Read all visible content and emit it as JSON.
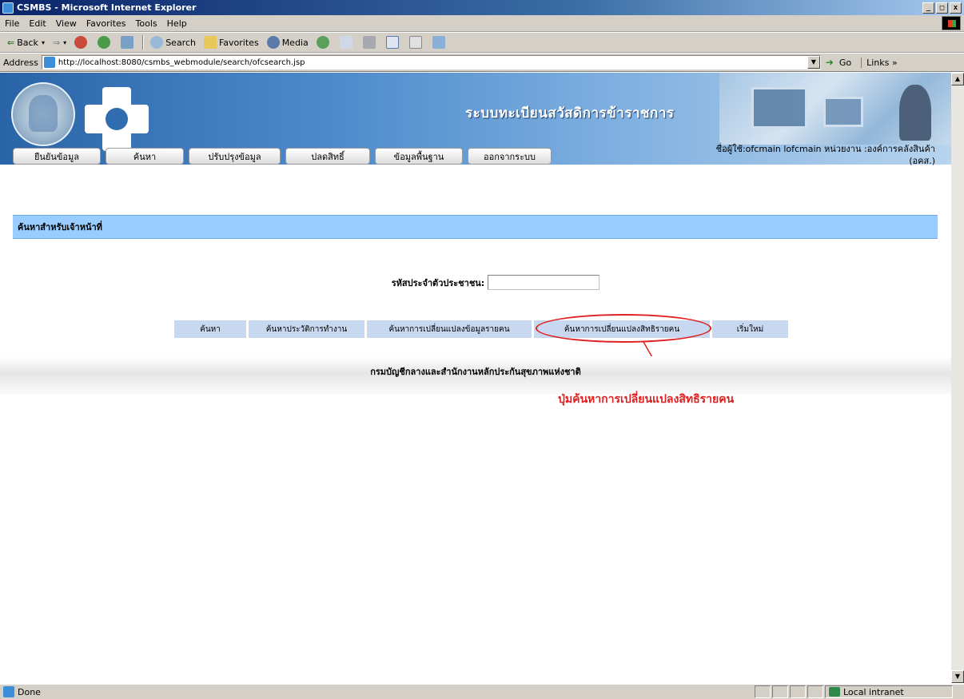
{
  "window": {
    "title": "CSMBS - Microsoft Internet Explorer",
    "controls": [
      "_",
      "□",
      "x"
    ]
  },
  "menubar": {
    "items": [
      "File",
      "Edit",
      "View",
      "Favorites",
      "Tools",
      "Help"
    ]
  },
  "toolbar": {
    "back": "Back",
    "search": "Search",
    "favorites": "Favorites",
    "media": "Media"
  },
  "address": {
    "label": "Address",
    "url": "http://localhost:8080/csmbs_webmodule/search/ofcsearch.jsp",
    "go": "Go",
    "links": "Links"
  },
  "banner": {
    "system_title": "ระบบทะเบียนสวัสดิการข้าราชการ"
  },
  "nav": {
    "items": [
      "ยืนยันข้อมูล",
      "ค้นหา",
      "ปรับปรุงข้อมูล",
      "ปลดสิทธิ์",
      "ข้อมูลพื้นฐาน",
      "ออกจากระบบ"
    ]
  },
  "user": {
    "info": "ชื่อผู้ใช้:ofcmain lofcmain หน่วยงาน :องค์การคลังสินค้า",
    "org_abbr": "(อคส.)"
  },
  "section": {
    "title": "ค้นหาสำหรับเจ้าหน้าที่"
  },
  "form": {
    "id_label": "รหัสประจำตัวประชาชน:",
    "id_value": ""
  },
  "actions": {
    "items": [
      "ค้นหา",
      "ค้นหาประวัติการทำงาน",
      "ค้นหาการเปลี่ยนแปลงข้อมูลรายคน",
      "ค้นหาการเปลี่ยนแปลงสิทธิรายคน",
      "เริ่มใหม่"
    ]
  },
  "footer": {
    "text": "กรมบัญชีกลางและสำนักงานหลักประกันสุขภาพแห่งชาติ"
  },
  "annotation": {
    "callout": "ปุ่มค้นหาการเปลี่ยนแปลงสิทธิรายคน",
    "color": "#e02020"
  },
  "status": {
    "text": "Done",
    "zone": "Local intranet"
  },
  "colors": {
    "section_head": "#99ccff",
    "action_button": "#c8d8f0",
    "banner_start": "#2a64a8"
  }
}
